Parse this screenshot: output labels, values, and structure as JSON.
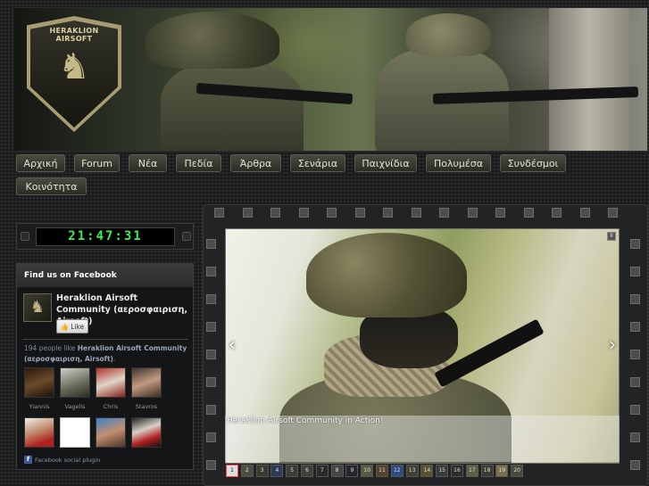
{
  "header": {
    "logo_text": "HERAKLION AIRSOFT"
  },
  "nav": {
    "items": [
      {
        "label": "Αρχική"
      },
      {
        "label": "Forum"
      },
      {
        "label": "Νέα"
      },
      {
        "label": "Πεδία"
      },
      {
        "label": "Άρθρα"
      },
      {
        "label": "Σενάρια"
      },
      {
        "label": "Παιχνίδια"
      },
      {
        "label": "Πολυμέσα"
      },
      {
        "label": "Συνδέσμοι"
      },
      {
        "label": "Κοινότητα"
      }
    ]
  },
  "clock": {
    "time": "21:47:31"
  },
  "facebook": {
    "header": "Find us on Facebook",
    "page_name": "Heraklion Airsoft Community (αεροσφαιριση, Airsoft)",
    "like_label": "Like",
    "count_prefix": "194 people like ",
    "count_page": "Heraklion Airsoft Community (αεροσφαιριση, Airsoft)",
    "count_suffix": ".",
    "friends": [
      {
        "name": "Yiannis"
      },
      {
        "name": "Vagelis"
      },
      {
        "name": "Chris"
      },
      {
        "name": "Stavros"
      },
      {
        "name": ""
      },
      {
        "name": ""
      },
      {
        "name": ""
      },
      {
        "name": ""
      }
    ],
    "footer": "Facebook social plugin"
  },
  "slider": {
    "caption": "Heraklion Airsoft Community in Action!",
    "prev": "‹",
    "next": "›",
    "pause": "II",
    "thumbs": [
      "1",
      "2",
      "3",
      "4",
      "5",
      "6",
      "7",
      "8",
      "9",
      "10",
      "11",
      "12",
      "13",
      "14",
      "15",
      "16",
      "17",
      "18",
      "19",
      "20"
    ],
    "active_thumb": "1"
  }
}
